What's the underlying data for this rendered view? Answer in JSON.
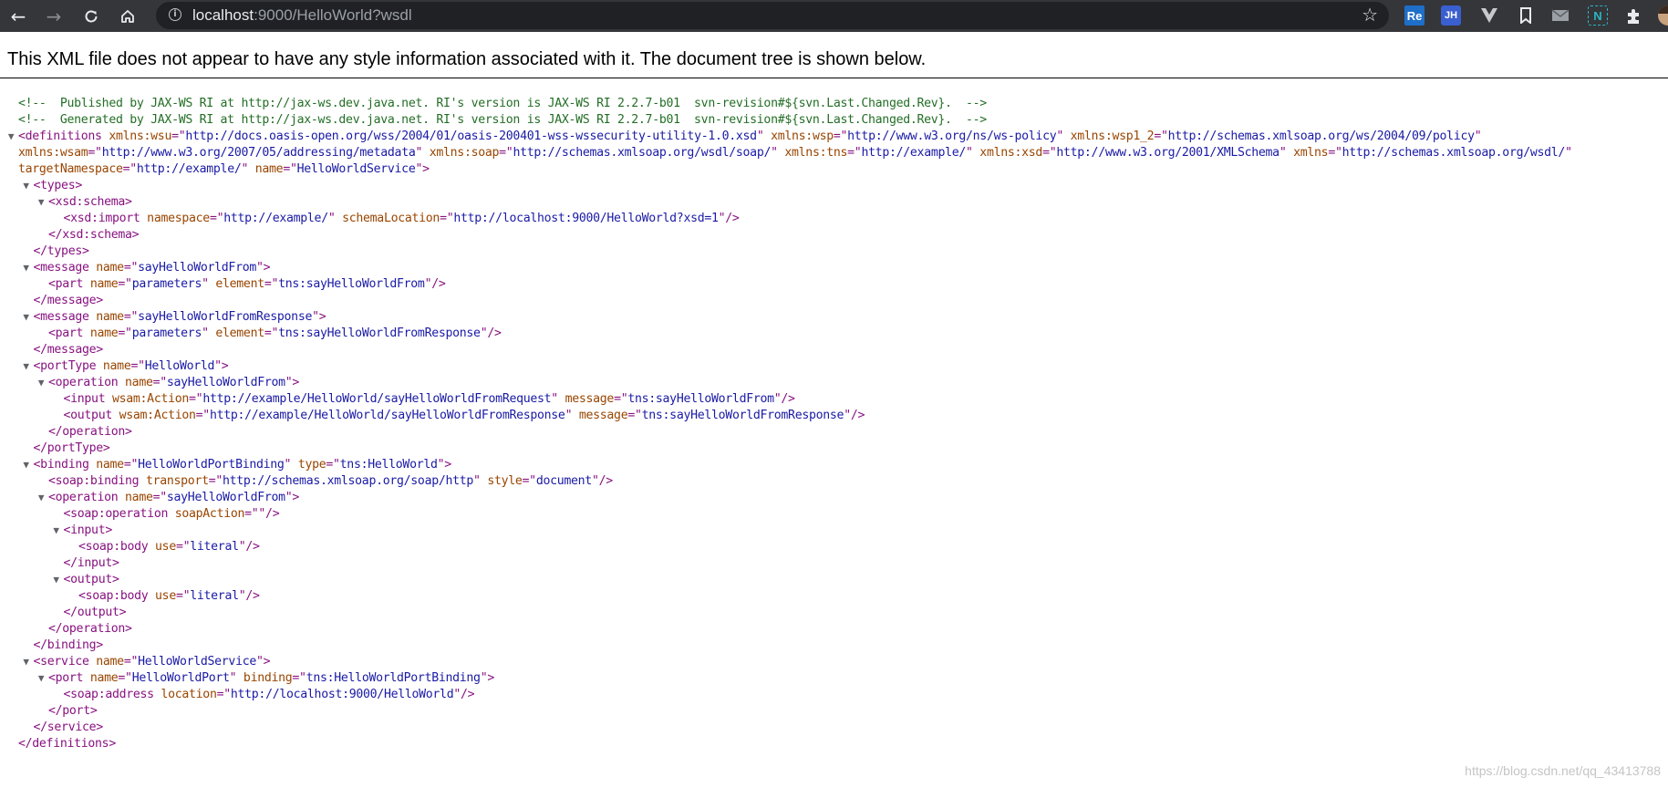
{
  "browser": {
    "url_host": "localhost",
    "url_rest": ":9000/HelloWorld?wsdl",
    "extensions": [
      {
        "name": "resume-extension-icon",
        "label": "Re",
        "bg": "#1e6fc8"
      },
      {
        "name": "jh-extension-icon",
        "label": "JH",
        "bg": "#3a5fd0"
      },
      {
        "name": "vue-devtools-extension-icon",
        "label": "",
        "bg": ""
      },
      {
        "name": "bookmark-extension-icon",
        "label": "",
        "bg": ""
      },
      {
        "name": "mail-extension-icon",
        "label": "",
        "bg": ""
      },
      {
        "name": "n-extension-icon",
        "label": "N",
        "bg": "#0e7c86"
      },
      {
        "name": "extensions-puzzle-icon",
        "label": "",
        "bg": ""
      },
      {
        "name": "profile-avatar",
        "label": "",
        "bg": ""
      }
    ]
  },
  "page": {
    "header": "This XML file does not appear to have any style information associated with it. The document tree is shown below.",
    "watermark": "https://blog.csdn.net/qq_43413788"
  },
  "colors": {
    "comment": "#236e25",
    "tag": "#881280",
    "attr_name": "#994500",
    "attr_value": "#1a1aa6"
  },
  "xml_lines": [
    {
      "arrow": false,
      "depth": 0,
      "segs": [
        {
          "k": "cm",
          "t": "<!--  Published by JAX-WS RI at http://jax-ws.dev.java.net. RI's version is JAX-WS RI 2.2.7-b01  svn-revision#${svn.Last.Changed.Rev}.  -->"
        }
      ]
    },
    {
      "arrow": false,
      "depth": 0,
      "segs": [
        {
          "k": "cm",
          "t": "<!--  Generated by JAX-WS RI at http://jax-ws.dev.java.net. RI's version is JAX-WS RI 2.2.7-b01  svn-revision#${svn.Last.Changed.Rev}.  -->"
        }
      ]
    },
    {
      "arrow": true,
      "depth": 0,
      "segs": [
        {
          "k": "tg",
          "t": "<definitions"
        },
        {
          "k": "an",
          "t": " xmlns:wsu"
        },
        {
          "k": "tg",
          "t": "=\""
        },
        {
          "k": "av",
          "t": "http://docs.oasis-open.org/wss/2004/01/oasis-200401-wss-wssecurity-utility-1.0.xsd"
        },
        {
          "k": "tg",
          "t": "\""
        },
        {
          "k": "an",
          "t": " xmlns:wsp"
        },
        {
          "k": "tg",
          "t": "=\""
        },
        {
          "k": "av",
          "t": "http://www.w3.org/ns/ws-policy"
        },
        {
          "k": "tg",
          "t": "\""
        },
        {
          "k": "an",
          "t": " xmlns:wsp1_2"
        },
        {
          "k": "tg",
          "t": "=\""
        },
        {
          "k": "av",
          "t": "http://schemas.xmlsoap.org/ws/2004/09/policy"
        },
        {
          "k": "tg",
          "t": "\""
        }
      ]
    },
    {
      "arrow": false,
      "depth": 0,
      "segs": [
        {
          "k": "an",
          "t": "xmlns:wsam"
        },
        {
          "k": "tg",
          "t": "=\""
        },
        {
          "k": "av",
          "t": "http://www.w3.org/2007/05/addressing/metadata"
        },
        {
          "k": "tg",
          "t": "\""
        },
        {
          "k": "an",
          "t": " xmlns:soap"
        },
        {
          "k": "tg",
          "t": "=\""
        },
        {
          "k": "av",
          "t": "http://schemas.xmlsoap.org/wsdl/soap/"
        },
        {
          "k": "tg",
          "t": "\""
        },
        {
          "k": "an",
          "t": " xmlns:tns"
        },
        {
          "k": "tg",
          "t": "=\""
        },
        {
          "k": "av",
          "t": "http://example/"
        },
        {
          "k": "tg",
          "t": "\""
        },
        {
          "k": "an",
          "t": " xmlns:xsd"
        },
        {
          "k": "tg",
          "t": "=\""
        },
        {
          "k": "av",
          "t": "http://www.w3.org/2001/XMLSchema"
        },
        {
          "k": "tg",
          "t": "\""
        },
        {
          "k": "an",
          "t": " xmlns"
        },
        {
          "k": "tg",
          "t": "=\""
        },
        {
          "k": "av",
          "t": "http://schemas.xmlsoap.org/wsdl/"
        },
        {
          "k": "tg",
          "t": "\""
        }
      ]
    },
    {
      "arrow": false,
      "depth": 0,
      "segs": [
        {
          "k": "an",
          "t": "targetNamespace"
        },
        {
          "k": "tg",
          "t": "=\""
        },
        {
          "k": "av",
          "t": "http://example/"
        },
        {
          "k": "tg",
          "t": "\""
        },
        {
          "k": "an",
          "t": " name"
        },
        {
          "k": "tg",
          "t": "=\""
        },
        {
          "k": "av",
          "t": "HelloWorldService"
        },
        {
          "k": "tg",
          "t": "\">"
        }
      ]
    },
    {
      "arrow": true,
      "depth": 1,
      "segs": [
        {
          "k": "tg",
          "t": "<types>"
        }
      ]
    },
    {
      "arrow": true,
      "depth": 2,
      "segs": [
        {
          "k": "tg",
          "t": "<xsd:schema>"
        }
      ]
    },
    {
      "arrow": false,
      "depth": 3,
      "segs": [
        {
          "k": "tg",
          "t": "<xsd:import"
        },
        {
          "k": "an",
          "t": " namespace"
        },
        {
          "k": "tg",
          "t": "=\""
        },
        {
          "k": "av",
          "t": "http://example/"
        },
        {
          "k": "tg",
          "t": "\""
        },
        {
          "k": "an",
          "t": " schemaLocation"
        },
        {
          "k": "tg",
          "t": "=\""
        },
        {
          "k": "av",
          "t": "http://localhost:9000/HelloWorld?xsd=1"
        },
        {
          "k": "tg",
          "t": "\"/>"
        }
      ]
    },
    {
      "arrow": false,
      "depth": 2,
      "segs": [
        {
          "k": "tg",
          "t": "</xsd:schema>"
        }
      ]
    },
    {
      "arrow": false,
      "depth": 1,
      "segs": [
        {
          "k": "tg",
          "t": "</types>"
        }
      ]
    },
    {
      "arrow": true,
      "depth": 1,
      "segs": [
        {
          "k": "tg",
          "t": "<message"
        },
        {
          "k": "an",
          "t": " name"
        },
        {
          "k": "tg",
          "t": "=\""
        },
        {
          "k": "av",
          "t": "sayHelloWorldFrom"
        },
        {
          "k": "tg",
          "t": "\">"
        }
      ]
    },
    {
      "arrow": false,
      "depth": 2,
      "segs": [
        {
          "k": "tg",
          "t": "<part"
        },
        {
          "k": "an",
          "t": " name"
        },
        {
          "k": "tg",
          "t": "=\""
        },
        {
          "k": "av",
          "t": "parameters"
        },
        {
          "k": "tg",
          "t": "\""
        },
        {
          "k": "an",
          "t": " element"
        },
        {
          "k": "tg",
          "t": "=\""
        },
        {
          "k": "av",
          "t": "tns:sayHelloWorldFrom"
        },
        {
          "k": "tg",
          "t": "\"/>"
        }
      ]
    },
    {
      "arrow": false,
      "depth": 1,
      "segs": [
        {
          "k": "tg",
          "t": "</message>"
        }
      ]
    },
    {
      "arrow": true,
      "depth": 1,
      "segs": [
        {
          "k": "tg",
          "t": "<message"
        },
        {
          "k": "an",
          "t": " name"
        },
        {
          "k": "tg",
          "t": "=\""
        },
        {
          "k": "av",
          "t": "sayHelloWorldFromResponse"
        },
        {
          "k": "tg",
          "t": "\">"
        }
      ]
    },
    {
      "arrow": false,
      "depth": 2,
      "segs": [
        {
          "k": "tg",
          "t": "<part"
        },
        {
          "k": "an",
          "t": " name"
        },
        {
          "k": "tg",
          "t": "=\""
        },
        {
          "k": "av",
          "t": "parameters"
        },
        {
          "k": "tg",
          "t": "\""
        },
        {
          "k": "an",
          "t": " element"
        },
        {
          "k": "tg",
          "t": "=\""
        },
        {
          "k": "av",
          "t": "tns:sayHelloWorldFromResponse"
        },
        {
          "k": "tg",
          "t": "\"/>"
        }
      ]
    },
    {
      "arrow": false,
      "depth": 1,
      "segs": [
        {
          "k": "tg",
          "t": "</message>"
        }
      ]
    },
    {
      "arrow": true,
      "depth": 1,
      "segs": [
        {
          "k": "tg",
          "t": "<portType"
        },
        {
          "k": "an",
          "t": " name"
        },
        {
          "k": "tg",
          "t": "=\""
        },
        {
          "k": "av",
          "t": "HelloWorld"
        },
        {
          "k": "tg",
          "t": "\">"
        }
      ]
    },
    {
      "arrow": true,
      "depth": 2,
      "segs": [
        {
          "k": "tg",
          "t": "<operation"
        },
        {
          "k": "an",
          "t": " name"
        },
        {
          "k": "tg",
          "t": "=\""
        },
        {
          "k": "av",
          "t": "sayHelloWorldFrom"
        },
        {
          "k": "tg",
          "t": "\">"
        }
      ]
    },
    {
      "arrow": false,
      "depth": 3,
      "segs": [
        {
          "k": "tg",
          "t": "<input"
        },
        {
          "k": "an",
          "t": " wsam:Action"
        },
        {
          "k": "tg",
          "t": "=\""
        },
        {
          "k": "av",
          "t": "http://example/HelloWorld/sayHelloWorldFromRequest"
        },
        {
          "k": "tg",
          "t": "\""
        },
        {
          "k": "an",
          "t": " message"
        },
        {
          "k": "tg",
          "t": "=\""
        },
        {
          "k": "av",
          "t": "tns:sayHelloWorldFrom"
        },
        {
          "k": "tg",
          "t": "\"/>"
        }
      ]
    },
    {
      "arrow": false,
      "depth": 3,
      "segs": [
        {
          "k": "tg",
          "t": "<output"
        },
        {
          "k": "an",
          "t": " wsam:Action"
        },
        {
          "k": "tg",
          "t": "=\""
        },
        {
          "k": "av",
          "t": "http://example/HelloWorld/sayHelloWorldFromResponse"
        },
        {
          "k": "tg",
          "t": "\""
        },
        {
          "k": "an",
          "t": " message"
        },
        {
          "k": "tg",
          "t": "=\""
        },
        {
          "k": "av",
          "t": "tns:sayHelloWorldFromResponse"
        },
        {
          "k": "tg",
          "t": "\"/>"
        }
      ]
    },
    {
      "arrow": false,
      "depth": 2,
      "segs": [
        {
          "k": "tg",
          "t": "</operation>"
        }
      ]
    },
    {
      "arrow": false,
      "depth": 1,
      "segs": [
        {
          "k": "tg",
          "t": "</portType>"
        }
      ]
    },
    {
      "arrow": true,
      "depth": 1,
      "segs": [
        {
          "k": "tg",
          "t": "<binding"
        },
        {
          "k": "an",
          "t": " name"
        },
        {
          "k": "tg",
          "t": "=\""
        },
        {
          "k": "av",
          "t": "HelloWorldPortBinding"
        },
        {
          "k": "tg",
          "t": "\""
        },
        {
          "k": "an",
          "t": " type"
        },
        {
          "k": "tg",
          "t": "=\""
        },
        {
          "k": "av",
          "t": "tns:HelloWorld"
        },
        {
          "k": "tg",
          "t": "\">"
        }
      ]
    },
    {
      "arrow": false,
      "depth": 2,
      "segs": [
        {
          "k": "tg",
          "t": "<soap:binding"
        },
        {
          "k": "an",
          "t": " transport"
        },
        {
          "k": "tg",
          "t": "=\""
        },
        {
          "k": "av",
          "t": "http://schemas.xmlsoap.org/soap/http"
        },
        {
          "k": "tg",
          "t": "\""
        },
        {
          "k": "an",
          "t": " style"
        },
        {
          "k": "tg",
          "t": "=\""
        },
        {
          "k": "av",
          "t": "document"
        },
        {
          "k": "tg",
          "t": "\"/>"
        }
      ]
    },
    {
      "arrow": true,
      "depth": 2,
      "segs": [
        {
          "k": "tg",
          "t": "<operation"
        },
        {
          "k": "an",
          "t": " name"
        },
        {
          "k": "tg",
          "t": "=\""
        },
        {
          "k": "av",
          "t": "sayHelloWorldFrom"
        },
        {
          "k": "tg",
          "t": "\">"
        }
      ]
    },
    {
      "arrow": false,
      "depth": 3,
      "segs": [
        {
          "k": "tg",
          "t": "<soap:operation"
        },
        {
          "k": "an",
          "t": " soapAction"
        },
        {
          "k": "tg",
          "t": "=\"\"/>"
        }
      ]
    },
    {
      "arrow": true,
      "depth": 3,
      "segs": [
        {
          "k": "tg",
          "t": "<input>"
        }
      ]
    },
    {
      "arrow": false,
      "depth": 4,
      "segs": [
        {
          "k": "tg",
          "t": "<soap:body"
        },
        {
          "k": "an",
          "t": " use"
        },
        {
          "k": "tg",
          "t": "=\""
        },
        {
          "k": "av",
          "t": "literal"
        },
        {
          "k": "tg",
          "t": "\"/>"
        }
      ]
    },
    {
      "arrow": false,
      "depth": 3,
      "segs": [
        {
          "k": "tg",
          "t": "</input>"
        }
      ]
    },
    {
      "arrow": true,
      "depth": 3,
      "segs": [
        {
          "k": "tg",
          "t": "<output>"
        }
      ]
    },
    {
      "arrow": false,
      "depth": 4,
      "segs": [
        {
          "k": "tg",
          "t": "<soap:body"
        },
        {
          "k": "an",
          "t": " use"
        },
        {
          "k": "tg",
          "t": "=\""
        },
        {
          "k": "av",
          "t": "literal"
        },
        {
          "k": "tg",
          "t": "\"/>"
        }
      ]
    },
    {
      "arrow": false,
      "depth": 3,
      "segs": [
        {
          "k": "tg",
          "t": "</output>"
        }
      ]
    },
    {
      "arrow": false,
      "depth": 2,
      "segs": [
        {
          "k": "tg",
          "t": "</operation>"
        }
      ]
    },
    {
      "arrow": false,
      "depth": 1,
      "segs": [
        {
          "k": "tg",
          "t": "</binding>"
        }
      ]
    },
    {
      "arrow": true,
      "depth": 1,
      "segs": [
        {
          "k": "tg",
          "t": "<service"
        },
        {
          "k": "an",
          "t": " name"
        },
        {
          "k": "tg",
          "t": "=\""
        },
        {
          "k": "av",
          "t": "HelloWorldService"
        },
        {
          "k": "tg",
          "t": "\">"
        }
      ]
    },
    {
      "arrow": true,
      "depth": 2,
      "segs": [
        {
          "k": "tg",
          "t": "<port"
        },
        {
          "k": "an",
          "t": " name"
        },
        {
          "k": "tg",
          "t": "=\""
        },
        {
          "k": "av",
          "t": "HelloWorldPort"
        },
        {
          "k": "tg",
          "t": "\""
        },
        {
          "k": "an",
          "t": " binding"
        },
        {
          "k": "tg",
          "t": "=\""
        },
        {
          "k": "av",
          "t": "tns:HelloWorldPortBinding"
        },
        {
          "k": "tg",
          "t": "\">"
        }
      ]
    },
    {
      "arrow": false,
      "depth": 3,
      "segs": [
        {
          "k": "tg",
          "t": "<soap:address"
        },
        {
          "k": "an",
          "t": " location"
        },
        {
          "k": "tg",
          "t": "=\""
        },
        {
          "k": "av",
          "t": "http://localhost:9000/HelloWorld"
        },
        {
          "k": "tg",
          "t": "\"/>"
        }
      ]
    },
    {
      "arrow": false,
      "depth": 2,
      "segs": [
        {
          "k": "tg",
          "t": "</port>"
        }
      ]
    },
    {
      "arrow": false,
      "depth": 1,
      "segs": [
        {
          "k": "tg",
          "t": "</service>"
        }
      ]
    },
    {
      "arrow": false,
      "depth": 0,
      "segs": [
        {
          "k": "tg",
          "t": "</definitions>"
        }
      ]
    }
  ]
}
